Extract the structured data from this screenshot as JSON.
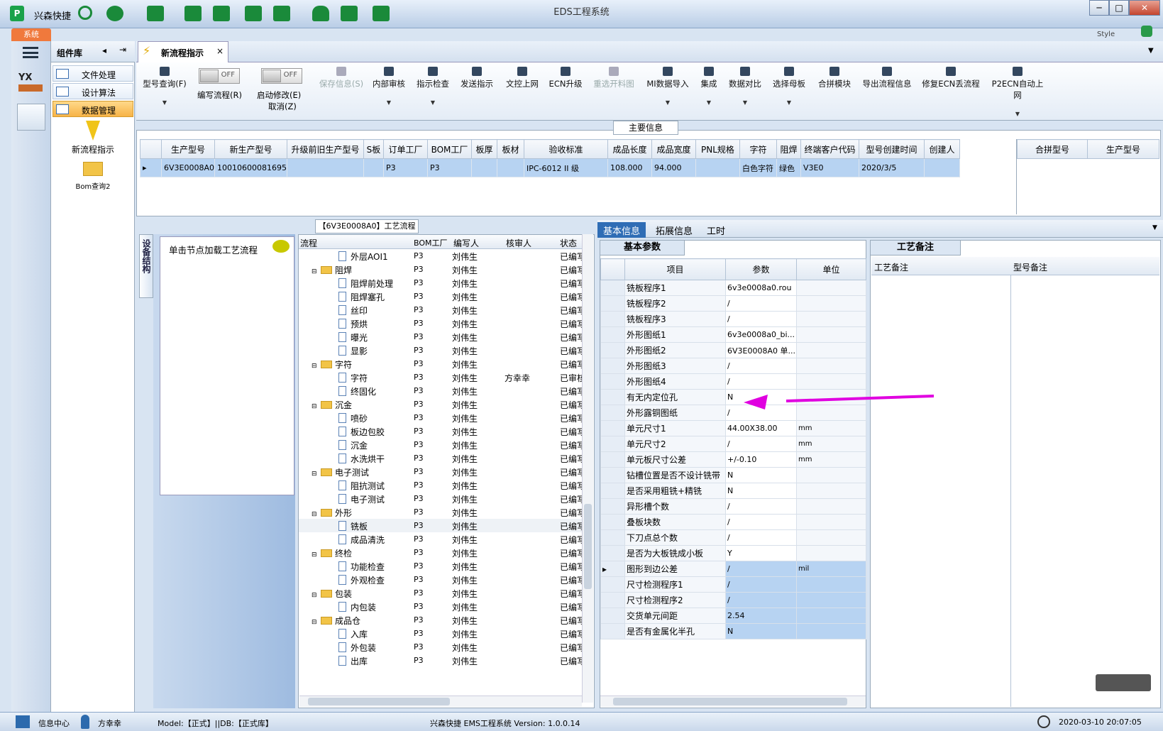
{
  "window": {
    "title": "EDS工程系统",
    "app_name": "兴森快捷",
    "style_label": "Style",
    "min": "─",
    "max": "□",
    "close": "✕"
  },
  "system_tab": "系统",
  "sidebar": {
    "header": "组件库",
    "items": [
      {
        "label": "文件处理"
      },
      {
        "label": "设计算法"
      },
      {
        "label": "数据管理"
      }
    ],
    "tools": [
      {
        "label": "新流程指示"
      },
      {
        "label": "Bom查询2"
      }
    ]
  },
  "doc_tab": {
    "label": "新流程指示",
    "close": "×"
  },
  "toolbar": {
    "buttons": [
      {
        "label": "型号查询(F)",
        "state": "enabled"
      },
      {
        "label": "保存信息(S)",
        "state": "disabled"
      },
      {
        "label": "内部审核",
        "state": "enabled"
      },
      {
        "label": "指示检查",
        "state": "enabled"
      },
      {
        "label": "发送指示",
        "state": "enabled"
      },
      {
        "label": "文控上网",
        "state": "enabled"
      },
      {
        "label": "ECN升级",
        "state": "enabled"
      },
      {
        "label": "重选开料图",
        "state": "disabled"
      },
      {
        "label": "MI数据导入",
        "state": "enabled"
      },
      {
        "label": "集成",
        "state": "enabled"
      },
      {
        "label": "数据对比",
        "state": "enabled"
      },
      {
        "label": "选择母板",
        "state": "enabled"
      },
      {
        "label": "合拼模块",
        "state": "enabled"
      },
      {
        "label": "导出流程信息",
        "state": "enabled"
      },
      {
        "label": "修复ECN丢流程",
        "state": "enabled"
      },
      {
        "label": "P2ECN自动上网",
        "state": "enabled"
      }
    ],
    "toggle1": {
      "state": "OFF",
      "label": "编写流程(R)"
    },
    "toggle2": {
      "state": "OFF",
      "label": "启动修改(E)",
      "label2": "取消(Z)"
    }
  },
  "main_info": {
    "title": "主要信息",
    "columns": [
      "生产型号",
      "新生产型号",
      "升级前旧生产型号",
      "S板",
      "订单工厂",
      "BOM工厂",
      "板厚",
      "板材",
      "验收标准",
      "成品长度",
      "成品宽度",
      "PNL规格",
      "字符",
      "阻焊",
      "终端客户代码",
      "型号创建时间",
      "创建人"
    ],
    "row": [
      "6V3E0008A0",
      "10010600081695",
      "",
      "",
      "P3",
      "P3",
      "",
      "",
      "IPC-6012 II 级",
      "108.000",
      "94.000",
      "",
      "白色字符",
      "绿色",
      "V3E0",
      "2020/3/5",
      ""
    ],
    "combo_columns": [
      "合拼型号",
      "生产型号"
    ]
  },
  "flow": {
    "title": "【6V3E0008A0】工艺流程",
    "left_tab": "设备结构",
    "hint": "单击节点加载工艺流程",
    "columns": [
      "流程",
      "BOM工厂",
      "编写人",
      "核审人",
      "状态"
    ],
    "rows": [
      {
        "name": "外层AOI1",
        "type": "doc",
        "bom": "P3",
        "writer": "刘伟生",
        "reviewer": "",
        "status": "已编写"
      },
      {
        "name": "阻焊",
        "type": "folder",
        "bom": "P3",
        "writer": "刘伟生",
        "reviewer": "",
        "status": "已编写"
      },
      {
        "name": "阻焊前处理",
        "type": "doc",
        "bom": "P3",
        "writer": "刘伟生",
        "reviewer": "",
        "status": "已编写"
      },
      {
        "name": "阻焊塞孔",
        "type": "doc",
        "bom": "P3",
        "writer": "刘伟生",
        "reviewer": "",
        "status": "已编写"
      },
      {
        "name": "丝印",
        "type": "doc",
        "bom": "P3",
        "writer": "刘伟生",
        "reviewer": "",
        "status": "已编写"
      },
      {
        "name": "预烘",
        "type": "doc",
        "bom": "P3",
        "writer": "刘伟生",
        "reviewer": "",
        "status": "已编写"
      },
      {
        "name": "曝光",
        "type": "doc",
        "bom": "P3",
        "writer": "刘伟生",
        "reviewer": "",
        "status": "已编写"
      },
      {
        "name": "显影",
        "type": "doc",
        "bom": "P3",
        "writer": "刘伟生",
        "reviewer": "",
        "status": "已编写"
      },
      {
        "name": "字符",
        "type": "folder",
        "bom": "P3",
        "writer": "刘伟生",
        "reviewer": "",
        "status": "已编写"
      },
      {
        "name": "字符",
        "type": "doc",
        "bom": "P3",
        "writer": "刘伟生",
        "reviewer": "方幸幸",
        "status": "已审核"
      },
      {
        "name": "终固化",
        "type": "doc",
        "bom": "P3",
        "writer": "刘伟生",
        "reviewer": "",
        "status": "已编写"
      },
      {
        "name": "沉金",
        "type": "folder",
        "bom": "P3",
        "writer": "刘伟生",
        "reviewer": "",
        "status": "已编写"
      },
      {
        "name": "喷砂",
        "type": "doc",
        "bom": "P3",
        "writer": "刘伟生",
        "reviewer": "",
        "status": "已编写"
      },
      {
        "name": "板边包胶",
        "type": "doc",
        "bom": "P3",
        "writer": "刘伟生",
        "reviewer": "",
        "status": "已编写"
      },
      {
        "name": "沉金",
        "type": "doc",
        "bom": "P3",
        "writer": "刘伟生",
        "reviewer": "",
        "status": "已编写"
      },
      {
        "name": "水洗烘干",
        "type": "doc",
        "bom": "P3",
        "writer": "刘伟生",
        "reviewer": "",
        "status": "已编写"
      },
      {
        "name": "电子测试",
        "type": "folder",
        "bom": "P3",
        "writer": "刘伟生",
        "reviewer": "",
        "status": "已编写"
      },
      {
        "name": "阻抗测试",
        "type": "doc",
        "bom": "P3",
        "writer": "刘伟生",
        "reviewer": "",
        "status": "已编写"
      },
      {
        "name": "电子测试",
        "type": "doc",
        "bom": "P3",
        "writer": "刘伟生",
        "reviewer": "",
        "status": "已编写"
      },
      {
        "name": "外形",
        "type": "folder",
        "bom": "P3",
        "writer": "刘伟生",
        "reviewer": "",
        "status": "已编写"
      },
      {
        "name": "铣板",
        "type": "doc",
        "bom": "P3",
        "writer": "刘伟生",
        "reviewer": "",
        "status": "已编写"
      },
      {
        "name": "成品清洗",
        "type": "doc",
        "bom": "P3",
        "writer": "刘伟生",
        "reviewer": "",
        "status": "已编写"
      },
      {
        "name": "终检",
        "type": "folder",
        "bom": "P3",
        "writer": "刘伟生",
        "reviewer": "",
        "status": "已编写"
      },
      {
        "name": "功能检查",
        "type": "doc",
        "bom": "P3",
        "writer": "刘伟生",
        "reviewer": "",
        "status": "已编写"
      },
      {
        "name": "外观检查",
        "type": "doc",
        "bom": "P3",
        "writer": "刘伟生",
        "reviewer": "",
        "status": "已编写"
      },
      {
        "name": "包装",
        "type": "folder",
        "bom": "P3",
        "writer": "刘伟生",
        "reviewer": "",
        "status": "已编写"
      },
      {
        "name": "内包装",
        "type": "doc",
        "bom": "P3",
        "writer": "刘伟生",
        "reviewer": "",
        "status": "已编写"
      },
      {
        "name": "成品仓",
        "type": "folder",
        "bom": "P3",
        "writer": "刘伟生",
        "reviewer": "",
        "status": "已编写"
      },
      {
        "name": "入库",
        "type": "doc",
        "bom": "P3",
        "writer": "刘伟生",
        "reviewer": "",
        "status": "已编写"
      },
      {
        "name": "外包装",
        "type": "doc",
        "bom": "P3",
        "writer": "刘伟生",
        "reviewer": "",
        "status": "已编写"
      },
      {
        "name": "出库",
        "type": "doc",
        "bom": "P3",
        "writer": "刘伟生",
        "reviewer": "",
        "status": "已编写"
      }
    ]
  },
  "right_tabs": [
    "基本信息",
    "拓展信息",
    "工时"
  ],
  "params": {
    "title": "基本参数",
    "columns": [
      "项目",
      "参数",
      "单位"
    ],
    "rows": [
      {
        "item": "铣板程序1",
        "value": "6v3e0008a0.rou",
        "unit": ""
      },
      {
        "item": "铣板程序2",
        "value": "/",
        "unit": ""
      },
      {
        "item": "铣板程序3",
        "value": "/",
        "unit": ""
      },
      {
        "item": "外形图纸1",
        "value": "6v3e0008a0_bi...",
        "unit": ""
      },
      {
        "item": "外形图纸2",
        "value": "6V3E0008A0 单...",
        "unit": ""
      },
      {
        "item": "外形图纸3",
        "value": "/",
        "unit": ""
      },
      {
        "item": "外形图纸4",
        "value": "/",
        "unit": ""
      },
      {
        "item": "有无内定位孔",
        "value": "N",
        "unit": ""
      },
      {
        "item": "外形露铜图纸",
        "value": "/",
        "unit": ""
      },
      {
        "item": "单元尺寸1",
        "value": "44.00X38.00",
        "unit": "mm"
      },
      {
        "item": "单元尺寸2",
        "value": "/",
        "unit": "mm"
      },
      {
        "item": "单元板尺寸公差",
        "value": "+/-0.10",
        "unit": "mm"
      },
      {
        "item": "钻槽位置是否不设计铣带",
        "value": "N",
        "unit": ""
      },
      {
        "item": "是否采用粗铣+精铣",
        "value": "N",
        "unit": ""
      },
      {
        "item": "异形槽个数",
        "value": "/",
        "unit": ""
      },
      {
        "item": "叠板块数",
        "value": "/",
        "unit": ""
      },
      {
        "item": "下刀点总个数",
        "value": "/",
        "unit": ""
      },
      {
        "item": "是否为大板铣成小板",
        "value": "Y",
        "unit": ""
      },
      {
        "item": "图形到边公差",
        "value": "/",
        "unit": "mil"
      },
      {
        "item": "尺寸检测程序1",
        "value": "/",
        "unit": ""
      },
      {
        "item": "尺寸检测程序2",
        "value": "/",
        "unit": ""
      },
      {
        "item": "交货单元间距",
        "value": "2.54",
        "unit": ""
      },
      {
        "item": "是否有金属化半孔",
        "value": "N",
        "unit": ""
      }
    ]
  },
  "remarks": {
    "title": "工艺备注",
    "columns": [
      "工艺备注",
      "型号备注"
    ]
  },
  "status": {
    "info_center": "信息中心",
    "user": "方幸幸",
    "model_db": "Model:【正式】||DB:【正式库】",
    "version": "兴森快捷 EMS工程系统 Version: 1.0.0.14",
    "datetime": "2020-03-10 20:07:05"
  },
  "colors": {
    "accent": "#2f6db5",
    "selected_nav": "#f7b347",
    "arrow": "#e000e0",
    "system_tab": "#f0793c"
  }
}
